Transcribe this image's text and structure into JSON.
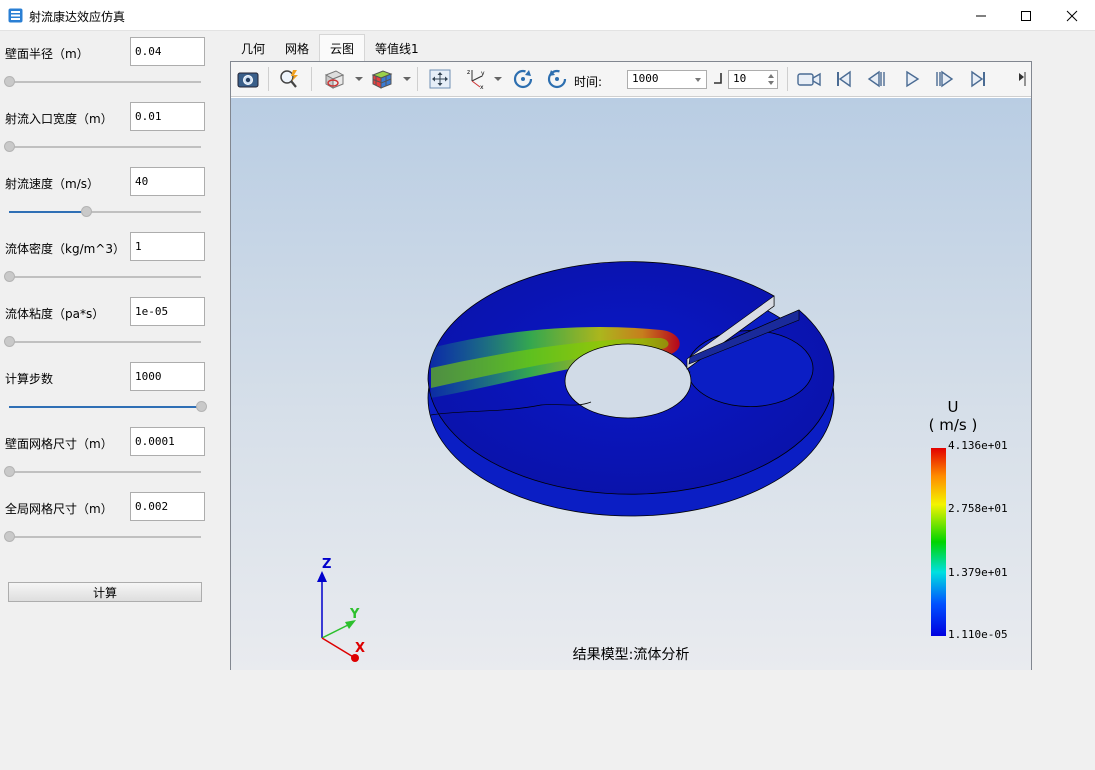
{
  "window": {
    "title": "射流康达效应仿真"
  },
  "params": [
    {
      "label": "壁面半径（m）",
      "value": "0.04",
      "slider": 0.0
    },
    {
      "label": "射流入口宽度（m）",
      "value": "0.01",
      "slider": 0.0
    },
    {
      "label": "射流速度（m/s）",
      "value": "40",
      "slider": 0.4
    },
    {
      "label": "流体密度（kg/m^3）",
      "value": "1",
      "slider": 0.0
    },
    {
      "label": "流体粘度（pa*s）",
      "value": "1e-05",
      "slider": 0.0
    },
    {
      "label": "计算步数",
      "value": "1000",
      "slider": 1.0
    },
    {
      "label": "壁面网格尺寸（m）",
      "value": "0.0001",
      "slider": 0.0
    },
    {
      "label": "全局网格尺寸（m）",
      "value": "0.002",
      "slider": 0.0
    }
  ],
  "calc_button": "计算",
  "tabs": [
    {
      "label": "几何",
      "active": false
    },
    {
      "label": "网格",
      "active": false
    },
    {
      "label": "云图",
      "active": true
    },
    {
      "label": "等值线1",
      "active": false
    }
  ],
  "toolbar": {
    "time_label": "时间:",
    "time_value": "1000",
    "step_value": "10"
  },
  "legend": {
    "title_line1": "U",
    "title_line2": "( m/s )",
    "ticks": [
      "4.136e+01",
      "2.758e+01",
      "1.379e+01",
      "1.110e-05"
    ]
  },
  "axes": {
    "z": "Z",
    "y": "Y",
    "x": "X"
  },
  "caption": "结果模型:流体分析",
  "colors": {
    "accent": "#2f6fb5",
    "field_low": "#0000c8",
    "field_high": "#e20000"
  }
}
